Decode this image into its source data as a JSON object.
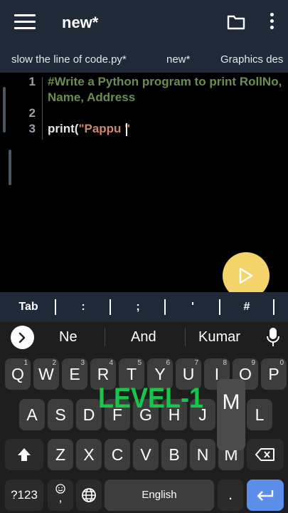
{
  "appbar": {
    "title": "new*"
  },
  "tabs": [
    "slow the line of code.py*",
    "new*",
    "Graphics des"
  ],
  "editor": {
    "line_numbers": [
      "1",
      "2",
      "3"
    ],
    "line1a": "#Write a Python program to print RollNo,",
    "line1b": "Name, Address",
    "line3_func": "print(",
    "line3_str": "\"Pappu \""
  },
  "symbols": [
    "Tab",
    ":",
    ";",
    "'",
    "#"
  ],
  "keyboard": {
    "suggestions": [
      "Ne",
      "And",
      "Kumar"
    ],
    "row1": [
      {
        "k": "Q",
        "h": "1"
      },
      {
        "k": "W",
        "h": "2"
      },
      {
        "k": "E",
        "h": "3"
      },
      {
        "k": "R",
        "h": "4"
      },
      {
        "k": "T",
        "h": "5"
      },
      {
        "k": "Y",
        "h": "6"
      },
      {
        "k": "U",
        "h": "7"
      },
      {
        "k": "I",
        "h": "8"
      },
      {
        "k": "O",
        "h": "9"
      },
      {
        "k": "P",
        "h": "0"
      }
    ],
    "row2": [
      "A",
      "S",
      "D",
      "F",
      "G",
      "H",
      "J",
      "K",
      "L"
    ],
    "row3": [
      "Z",
      "X",
      "C",
      "V",
      "B",
      "N",
      "M"
    ],
    "symbols_key": "?123",
    "space_label": "English",
    "period_key": ".",
    "popup_letter": "M"
  },
  "overlay_text": "LEVEL-1",
  "colors": {
    "run_button": "#f3d36a",
    "enter_key": "#5a8ee8",
    "overlay": "#17c64a"
  }
}
